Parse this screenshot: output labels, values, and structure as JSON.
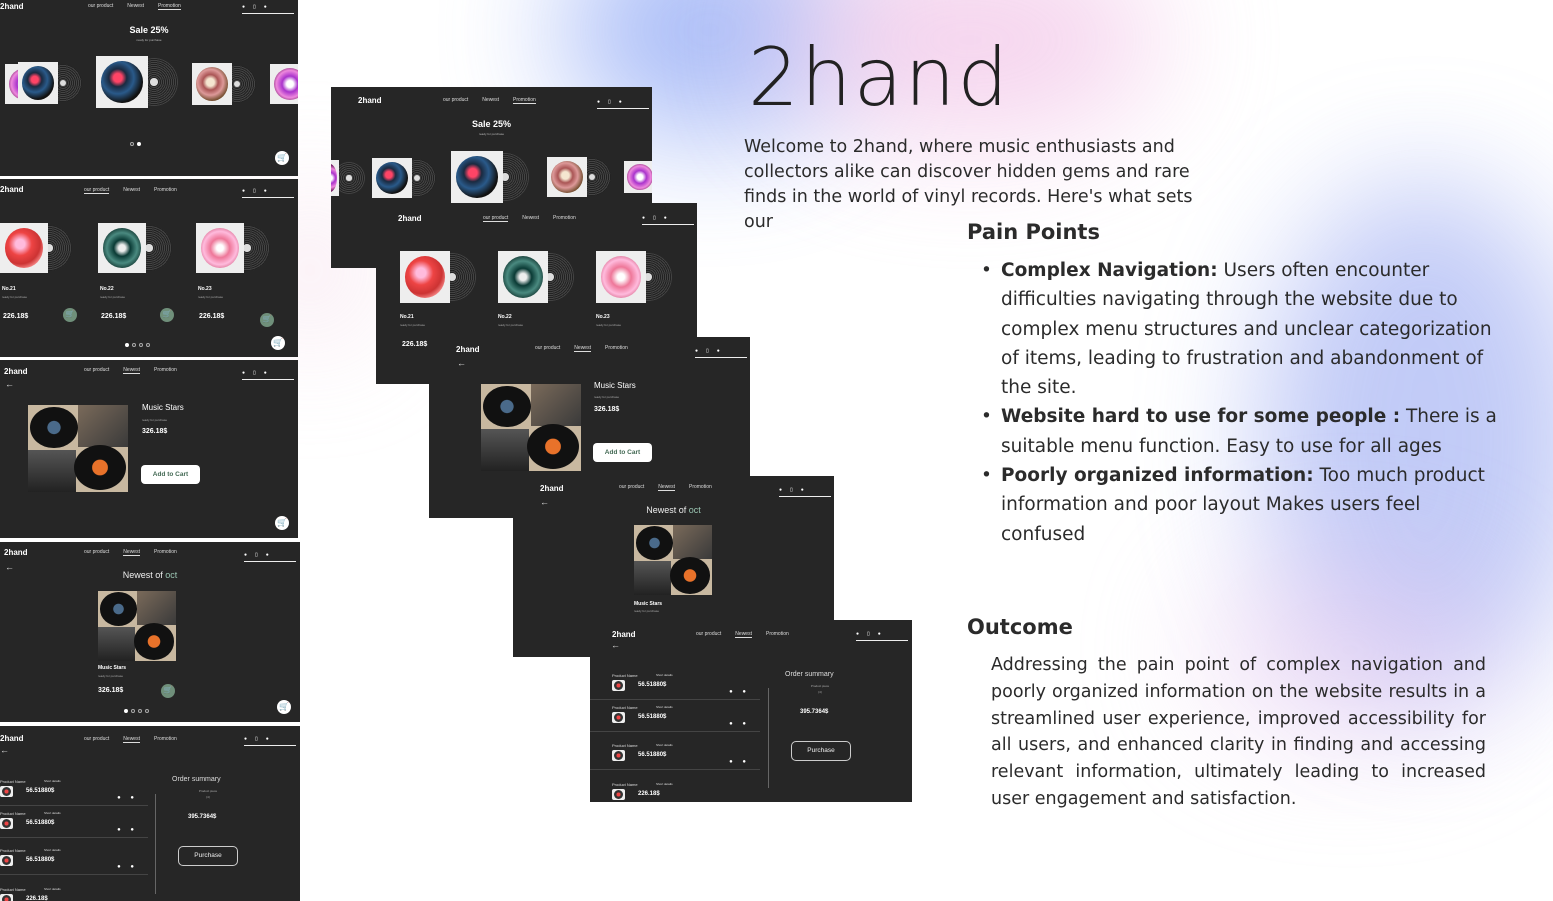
{
  "brand": {
    "title": "2hand"
  },
  "intro": "Welcome to 2hand,  where music enthusiasts and collectors alike can discover hidden gems and rare finds in the world of vinyl records. Here's what sets our",
  "pain_points": {
    "title": "Pain Points",
    "items": [
      {
        "label": "Complex Navigation:",
        "text": " Users often encounter difficulties navigating through the website due to complex menu structures and unclear categorization of items, leading to frustration and abandonment of the site."
      },
      {
        "label": "Website hard to use for some people :",
        "text": " There is a suitable menu function. Easy to use for all ages"
      },
      {
        "label": "Poorly organized information:",
        "text": " Too much product information and poor layout Makes users feel confused"
      }
    ]
  },
  "outcome": {
    "title": "Outcome",
    "text": "Addressing the pain point of complex navigation and poorly organized information on the website results in a streamlined user experience, improved accessibility for all users, and enhanced clarity in finding and accessing relevant information, ultimately leading to increased user engagement and satisfaction."
  },
  "mockup": {
    "logo": "2hand",
    "nav": [
      "our product",
      "Newest",
      "Promotion"
    ],
    "nav_icons": [
      "●",
      "▯",
      "●"
    ],
    "sale_title": "Sale 25%",
    "sale_sub": "ready for purchase",
    "products": [
      {
        "name": "No.21",
        "sub": "ready for purchase",
        "price": "226.18$"
      },
      {
        "name": "No.22",
        "sub": "ready for purchase",
        "price": "226.18$"
      },
      {
        "name": "No.23",
        "sub": "ready for purchase",
        "price": "226.18$"
      }
    ],
    "price_cut": "226.18$",
    "detail": {
      "name": "Music Stars",
      "sub": "ready for purchase",
      "price": "326.18$",
      "button": "Add to Cart"
    },
    "newest": {
      "title": "Newest of",
      "accent": "oct",
      "name": "Music Stars",
      "sub": "ready for purchase",
      "price": "326.18$"
    },
    "cart": {
      "rows": [
        {
          "name": "Product Name",
          "detail": "Short details",
          "price": "56.51880$"
        },
        {
          "name": "Product Name",
          "detail": "Short details",
          "price": "56.51880$"
        },
        {
          "name": "Product Name",
          "detail": "Short details",
          "price": "56.51880$"
        },
        {
          "name": "Product Name",
          "detail": "Short details",
          "price": "226.18$"
        }
      ],
      "row_dots": "● ●",
      "summary_title": "Order summary",
      "summary_sub": "Product piece",
      "summary_count": "(4)",
      "total": "395.7364$",
      "button": "Purchase"
    },
    "back_arrow": "←",
    "cart_icon": "🛒",
    "cart_small": "🛒"
  },
  "colors": {
    "screen_bg": "#262626",
    "accent_green": "#6f8f7a",
    "accent_mint": "#9cc7b4"
  }
}
